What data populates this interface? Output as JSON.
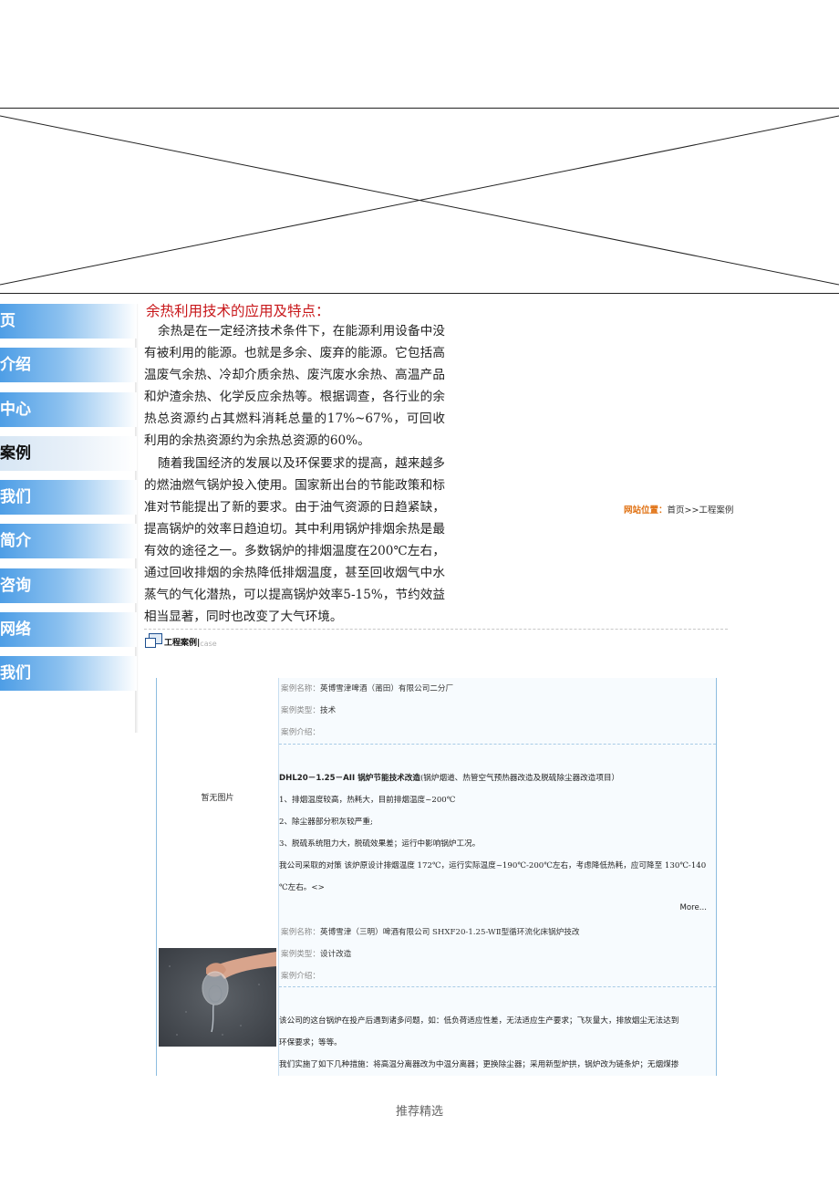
{
  "nav": {
    "items": [
      {
        "label": "页"
      },
      {
        "label": "介绍"
      },
      {
        "label": "中心"
      },
      {
        "label": "案例"
      },
      {
        "label": "我们"
      },
      {
        "label": "简介"
      },
      {
        "label": "咨询"
      },
      {
        "label": "网络"
      },
      {
        "label": "我们"
      }
    ],
    "active": "案例"
  },
  "article": {
    "title": "余热利用技术的应用及特点：",
    "paragraphs": [
      "余热是在一定经济技术条件下，在能源利用设备中没有被利用的能源。也就是多余、废弃的能源。它包括高温废气余热、冷却介质余热、废汽废水余热、高温产品和炉渣余热、化学反应余热等。根据调查，各行业的余热总资源约占其燃料消耗总量的17%~67%，可回收利用的余热资源约为余热总资源的60%。",
      "随着我国经济的发展以及环保要求的提高，越来越多的燃油燃气锅炉投入使用。国家新出台的节能政策和标准对节能提出了新的要求。由于油气资源的日趋紧缺，提高锅炉的效率日趋迫切。其中利用锅炉排烟余热是最有效的途径之一。多数锅炉的排烟温度在200℃左右，通过回收排烟的余热降低排烟温度，甚至回收烟气中水蒸气的气化潜热，可以提高锅炉效率5-15%，节约效益相当显著，同时也改变了大气环境。"
    ]
  },
  "location": {
    "label": "网站位置：",
    "path": "首页>>工程案例"
  },
  "section": {
    "title": "工程案例|",
    "subtitle": "case"
  },
  "cases": {
    "no_image": "暂无图片",
    "name_label": "案例名称：",
    "type_label": "案例类型：",
    "intro_label": "案例介绍：",
    "more": "More...",
    "case1": {
      "name": "英博雪津啤酒（莆田）有限公司二分厂",
      "type": "技术",
      "headline_bold": "DHL20－1.25－AII 锅炉节能技术改造",
      "headline_rest": "(锅炉烟道、热管空气预热器改造及脱硫除尘器改造项目）",
      "l1": "1、排烟温度较高，热耗大，目前排烟温度~200℃",
      "l2": "2、除尘器部分积灰较严重;",
      "l3": "3、脱硫系统阻力大，脱硫效果差；运行中影响锅炉工况。",
      "l4": "我公司采取的对策 该炉原设计排烟温度 172℃，运行实际温度~190℃-200℃左右，考虑降低热耗，应可降至 130℃-140",
      "l5": "℃左右。<>"
    },
    "case2": {
      "name": "英博雪津（三明）啤酒有限公司 SHXF20-1.25-WⅡ型循环流化床锅炉技改",
      "type": "设计改造",
      "l1": "该公司的这台锅炉在投产后遇到诸多问题，如：低负荷适应性差，无法适应生产要求；飞灰量大，排放烟尘无法达到",
      "l2": "环保要求；等等。",
      "l3": "我们实施了如下几种措施：将高温分离器改为中温分离器；更换除尘器；采用新型炉拱，锅炉改为链条炉；无烟煤掺"
    }
  },
  "footer": {
    "text": "推荐精选"
  }
}
